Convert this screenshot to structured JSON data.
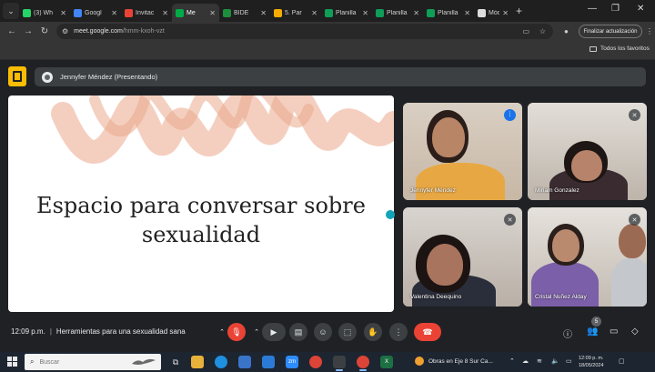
{
  "browser": {
    "tabs": [
      {
        "label": "(3) Wh",
        "icon": "whatsapp-icon",
        "color": "#25d366",
        "active": false
      },
      {
        "label": "Googl",
        "icon": "google-icon",
        "color": "#4285f4",
        "active": false
      },
      {
        "label": "Invitac",
        "icon": "gmail-icon",
        "color": "#ea4335",
        "active": false
      },
      {
        "label": "Me",
        "icon": "meet-icon",
        "color": "#00ac47",
        "active": true
      },
      {
        "label": "BIDE",
        "icon": "bide-icon",
        "color": "#1e8e3e",
        "active": false
      },
      {
        "label": "5. Par",
        "icon": "drive-icon",
        "color": "#f9ab00",
        "active": false
      },
      {
        "label": "Planilla",
        "icon": "sheets-icon",
        "color": "#0f9d58",
        "active": false
      },
      {
        "label": "Planilla",
        "icon": "sheets-icon",
        "color": "#0f9d58",
        "active": false
      },
      {
        "label": "Planilla",
        "icon": "sheets-icon",
        "color": "#0f9d58",
        "active": false
      },
      {
        "label": "Módul",
        "icon": "page-icon",
        "color": "#dddddd",
        "active": false
      }
    ],
    "new_tab": "+",
    "url_host": "meet.google.com",
    "url_path": "/hmm-kxoh-vzt",
    "update_button": "Finalizar actualización",
    "bookmarks_all": "Todos los favoritos"
  },
  "meet": {
    "presenter": "Jennyfer Méndez (Presentando)",
    "slide": {
      "title_line1": "Espacio para conversar sobre",
      "title_line2": "sexualidad"
    },
    "participants": [
      {
        "name": "Jennyfer Méndez",
        "speaking": true
      },
      {
        "name": "Miriam Gonzalez",
        "speaking": false
      },
      {
        "name": "Valentina Deequino",
        "speaking": false
      },
      {
        "name": "Cristal Nuñez Alday",
        "speaking": false
      }
    ],
    "time": "12:09 p.m.",
    "meeting_name": "Herramientas para una sexualidad sana",
    "people_count": "5",
    "colors": {
      "end_call": "#ea4335",
      "speaking": "#8ab4f8",
      "logo": "#fbbc04"
    }
  },
  "taskbar": {
    "search_placeholder": "Buscar",
    "weather": "Obras en Eje 8 Sur Ca...",
    "clock_time": "12:09 p. m.",
    "clock_date": "18/05/2024"
  }
}
